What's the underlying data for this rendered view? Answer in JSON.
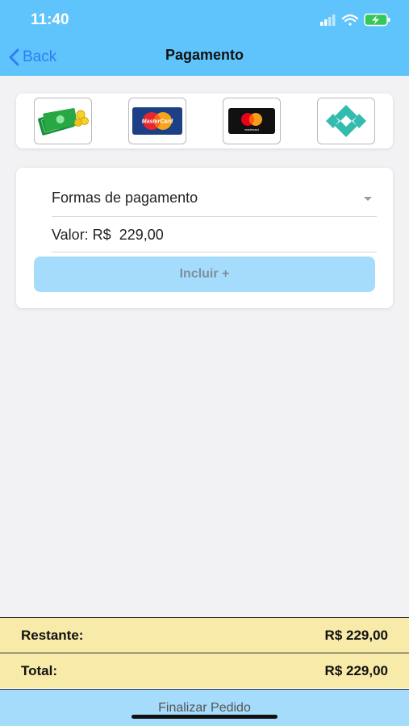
{
  "status_bar": {
    "time": "11:40"
  },
  "nav": {
    "back_label": "Back",
    "title": "Pagamento"
  },
  "payment_methods": [
    {
      "name": "cash-icon"
    },
    {
      "name": "mastercard-card-icon"
    },
    {
      "name": "mastercard-icon"
    },
    {
      "name": "pix-icon"
    }
  ],
  "form": {
    "payment_select_label": "Formas de pagamento",
    "value_label": "Valor: R$  229,00",
    "include_button_label": "Incluir +"
  },
  "summary": {
    "remaining_label": "Restante:",
    "remaining_value": "R$ 229,00",
    "total_label": "Total:",
    "total_value": "R$ 229,00"
  },
  "footer": {
    "finalize_label": "Finalizar Pedido"
  },
  "colors": {
    "header": "#5fc4fb",
    "summary": "#f8eaa8",
    "button": "#a6dcfb",
    "link": "#2f7cf6"
  }
}
